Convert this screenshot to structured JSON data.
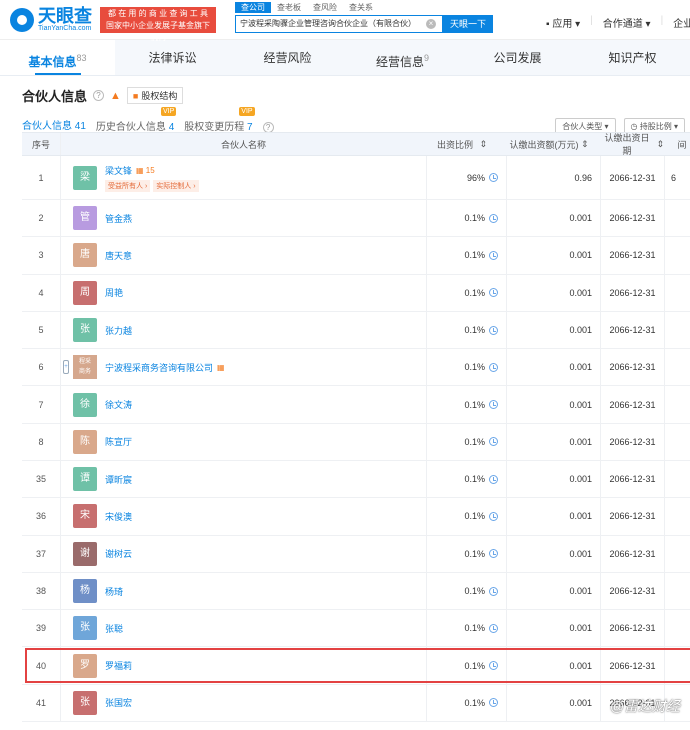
{
  "header": {
    "logo_name": "天眼查",
    "logo_domain": "TianYanCha.com",
    "promo_line1": "都 在 用 的 商 业 查 询 工 具",
    "promo_line2": "国家中小企业发展子基金旗下机构",
    "search_tabs": [
      "查公司",
      "查老板",
      "查风险",
      "查关系"
    ],
    "search_value": "宁波程采陶骤企业管理咨询合伙企业（有限合伙）",
    "search_button": "天眼一下",
    "nav_app": "应用",
    "nav_coop": "合作通道",
    "nav_rank": "企业级产"
  },
  "tabs": [
    {
      "label": "基本信息",
      "count": "83"
    },
    {
      "label": "法律诉讼",
      "count": ""
    },
    {
      "label": "经营风险",
      "count": ""
    },
    {
      "label": "经营信息",
      "count": "9"
    },
    {
      "label": "公司发展",
      "count": ""
    },
    {
      "label": "知识产权",
      "count": ""
    }
  ],
  "section": {
    "title": "合伙人信息",
    "equity_button": "股权结构",
    "subtabs": [
      {
        "label": "合伙人信息",
        "count": "41"
      },
      {
        "label": "历史合伙人信息",
        "count": "4"
      },
      {
        "label": "股权变更历程",
        "count": "7"
      }
    ],
    "vip_label": "VIP",
    "filter_type": "合伙人类型",
    "filter_ratio": "持股比例"
  },
  "table": {
    "headers": {
      "seq": "序号",
      "name": "合伙人名称",
      "ratio": "出资比例",
      "amount": "认缴出资额(万元)",
      "date": "认缴出资日期",
      "extra": "间"
    },
    "row1": {
      "seq": "1",
      "avatar": "梁",
      "name": "梁文锋",
      "share_count": "15",
      "tag1": "受益所有人",
      "tag2": "实际控制人",
      "ratio": "96%",
      "amount": "0.96",
      "date": "2066-12-31",
      "extra": "6"
    },
    "rows": [
      {
        "seq": "2",
        "avatar": "管",
        "name": "管金燕",
        "ratio": "0.1%",
        "amount": "0.001",
        "date": "2066-12-31",
        "color": "#b89be0"
      },
      {
        "seq": "3",
        "avatar": "唐",
        "name": "唐天意",
        "ratio": "0.1%",
        "amount": "0.001",
        "date": "2066-12-31",
        "color": "#d9a88b"
      },
      {
        "seq": "4",
        "avatar": "周",
        "name": "周艳",
        "ratio": "0.1%",
        "amount": "0.001",
        "date": "2066-12-31",
        "color": "#c76f6f"
      },
      {
        "seq": "5",
        "avatar": "张",
        "name": "张力越",
        "ratio": "0.1%",
        "amount": "0.001",
        "date": "2066-12-31",
        "color": "#6fc1a7"
      }
    ],
    "company_row": {
      "seq": "6",
      "logo_line1": "程采",
      "logo_line2": "商务",
      "name": "宁波程采商务咨询有限公司",
      "ratio": "0.1%",
      "amount": "0.001",
      "date": "2066-12-31"
    },
    "rows_b": [
      {
        "seq": "7",
        "avatar": "徐",
        "name": "徐文涛",
        "ratio": "0.1%",
        "amount": "0.001",
        "date": "2066-12-31",
        "color": "#6fc1a7"
      },
      {
        "seq": "8",
        "avatar": "陈",
        "name": "陈宣厅",
        "ratio": "0.1%",
        "amount": "0.001",
        "date": "2066-12-31",
        "color": "#d9a88b"
      }
    ],
    "rows_c": [
      {
        "seq": "35",
        "avatar": "谭",
        "name": "谭昕宸",
        "ratio": "0.1%",
        "amount": "0.001",
        "date": "2066-12-31",
        "color": "#6fc1a7"
      },
      {
        "seq": "36",
        "avatar": "宋",
        "name": "宋俊澳",
        "ratio": "0.1%",
        "amount": "0.001",
        "date": "2066-12-31",
        "color": "#c76f6f"
      },
      {
        "seq": "37",
        "avatar": "谢",
        "name": "谢树云",
        "ratio": "0.1%",
        "amount": "0.001",
        "date": "2066-12-31",
        "color": "#9a6b6b"
      },
      {
        "seq": "38",
        "avatar": "杨",
        "name": "杨琦",
        "ratio": "0.1%",
        "amount": "0.001",
        "date": "2066-12-31",
        "color": "#6f8fc7"
      },
      {
        "seq": "39",
        "avatar": "张",
        "name": "张聪",
        "ratio": "0.1%",
        "amount": "0.001",
        "date": "2066-12-31",
        "color": "#6fa6d9"
      },
      {
        "seq": "40",
        "avatar": "罗",
        "name": "罗福莉",
        "ratio": "0.1%",
        "amount": "0.001",
        "date": "2066-12-31",
        "color": "#d9a88b"
      },
      {
        "seq": "41",
        "avatar": "张",
        "name": "张国宏",
        "ratio": "0.1%",
        "amount": "0.001",
        "date": "2066-12-31",
        "color": "#c76f6f"
      }
    ]
  },
  "watermark": "@雷达财经"
}
